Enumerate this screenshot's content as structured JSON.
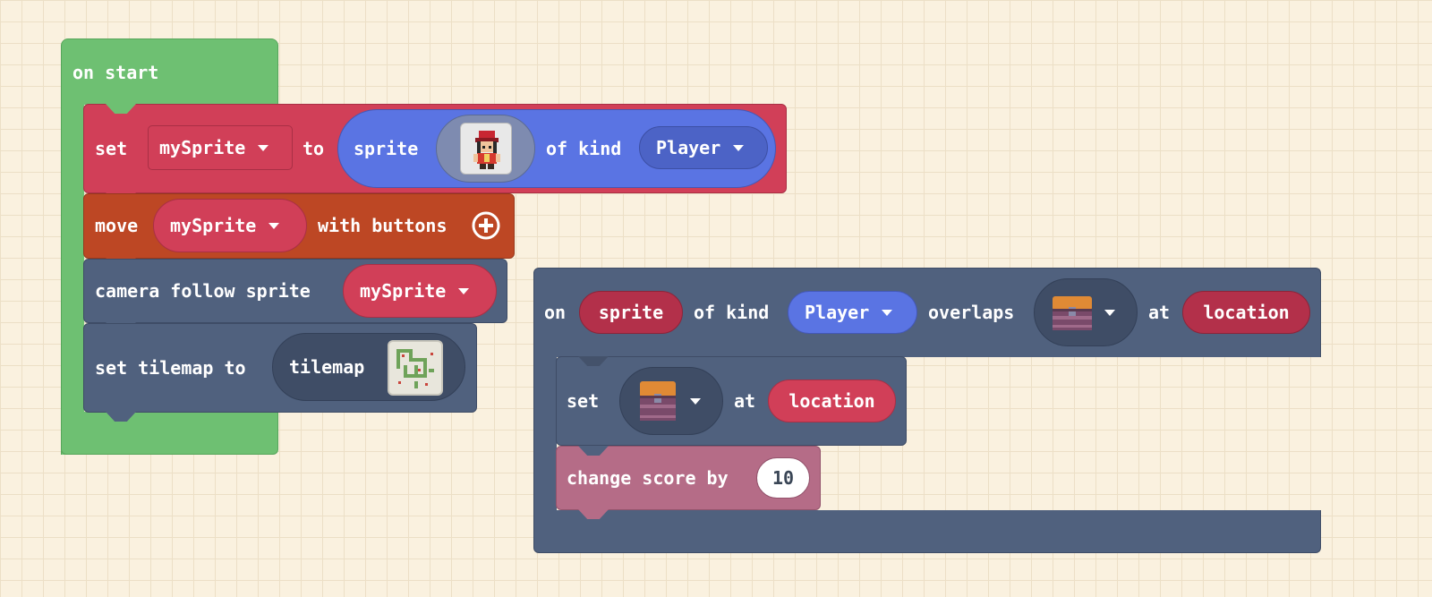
{
  "on_start": {
    "hat_label": "on start",
    "set_sprite": {
      "set_label": "set",
      "variable": "mySprite",
      "to_label": "to",
      "sprite_label": "sprite",
      "of_kind_label": "of kind",
      "kind": "Player"
    },
    "move": {
      "move_label": "move",
      "variable": "mySprite",
      "with_buttons_label": "with buttons"
    },
    "camera": {
      "label": "camera follow sprite",
      "variable": "mySprite"
    },
    "tilemap": {
      "label": "set tilemap to",
      "tilemap_label": "tilemap"
    }
  },
  "overlap_event": {
    "on_label": "on",
    "sprite_label": "sprite",
    "of_kind_label": "of kind",
    "kind": "Player",
    "overlaps_label": "overlaps",
    "at_label": "at",
    "location_label": "location",
    "set_tile": {
      "set_label": "set",
      "at_label": "at",
      "location_label": "location"
    },
    "change_score": {
      "label": "change score by",
      "value": "10"
    }
  },
  "colors": {
    "background": "#faf1df",
    "event_green": "#6ec072",
    "sprites_red": "#d13f58",
    "controller_orange": "#bd4724",
    "scene_slate": "#50617e",
    "kind_blue": "#5a74e3",
    "info_pink": "#b56c87"
  },
  "icons": {
    "sprite_image": "player-character",
    "tile_image": "treasure-chest",
    "tilemap_image": "maze-tilemap",
    "plus": "plus-circle-icon"
  }
}
